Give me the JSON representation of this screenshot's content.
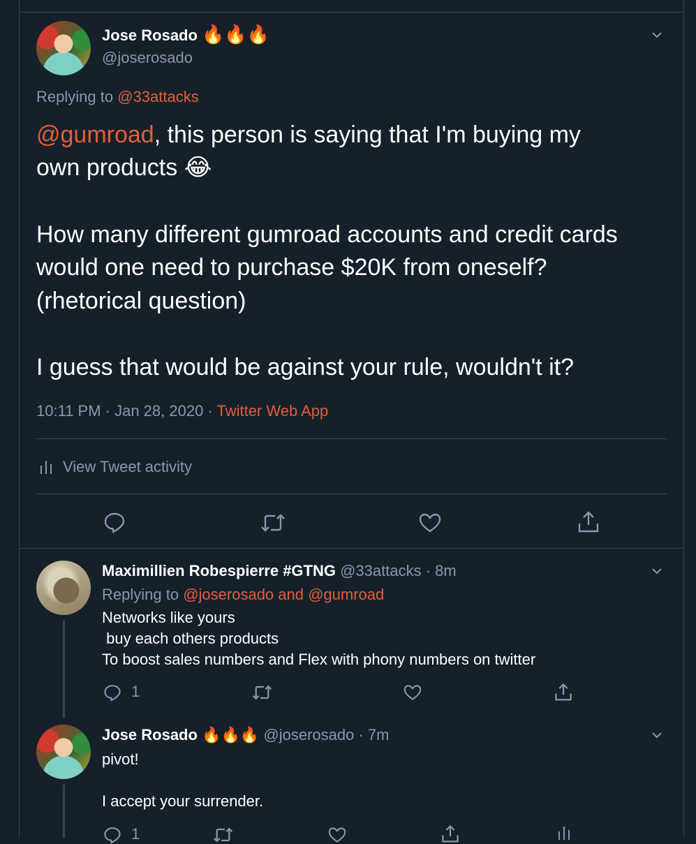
{
  "main_tweet": {
    "name": "Jose Rosado",
    "name_emoji": "🔥🔥🔥",
    "handle": "@joserosado",
    "replying_prefix": "Replying to",
    "replying_to": "@33attacks",
    "mention": "@gumroad",
    "text_line1_rest": ", this person is saying that I'm buying my",
    "text_line2": "own products",
    "text_line2_emoji": "😂",
    "text_p2_line1": "How many different gumroad accounts and credit cards",
    "text_p2_line2": "would one need to purchase $20K from oneself?",
    "text_p2_line3": "(rhetorical question)",
    "text_p3": "I guess that would be against your rule, wouldn't it?",
    "timestamp": "10:11 PM · Jan 28, 2020 ·",
    "source": "Twitter Web App",
    "activity_label": "View Tweet activity"
  },
  "reply1": {
    "name": "Maximillien Robespierre #GTNG",
    "handle": "@33attacks",
    "time": "· 8m",
    "replying_prefix": "Replying to",
    "replying_to": "@joserosado and @gumroad",
    "line1": "Networks like yours",
    "line2": " buy each others products",
    "line3": "To boost sales numbers and Flex with phony numbers on twitter",
    "reply_count": "1"
  },
  "reply2": {
    "name": "Jose Rosado",
    "name_emoji": "🔥🔥🔥",
    "handle": "@joserosado",
    "time": "· 7m",
    "line1": "pivot!",
    "line2": "I accept your surrender.",
    "reply_count": "1"
  },
  "colors": {
    "background": "#15202b",
    "accent": "#e0603a",
    "muted": "#8899a6",
    "divider": "#38444d"
  }
}
